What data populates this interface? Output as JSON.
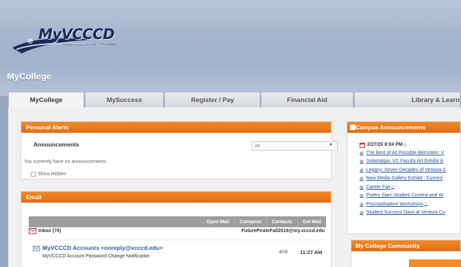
{
  "brand": {
    "logo_text": "MyVCCCD",
    "logo_tagline": "Ventura County Community College District",
    "site_title": "MyCollege"
  },
  "tabs": [
    {
      "label": "MyCollege",
      "active": true
    },
    {
      "label": "MySuccess",
      "active": false
    },
    {
      "label": "Register / Pay",
      "active": false
    },
    {
      "label": "Financial Aid",
      "active": false
    },
    {
      "label": "Library & Learn",
      "active": false
    }
  ],
  "alerts": {
    "header": "Personal Alerts",
    "announcements_title": "Announcements",
    "filter_value": "All",
    "empty_text": "You currently have no announcements.",
    "show_hidden_label": "Show Hidden"
  },
  "email": {
    "header": "Email",
    "toolbar": [
      "Open Mail",
      "Compose",
      "Contacts",
      "Get Mail"
    ],
    "inbox_label": "Inbox (70)",
    "account": "FuturePirateFall2019@my.vcccd.edu",
    "messages": [
      {
        "from": "MyVCCCD Accounts <noreply@vcccd.edu>",
        "subject": "MyVCCCD Account Password Change Notification",
        "size": "4KB",
        "time": "11:27 AM"
      }
    ]
  },
  "campus": {
    "header": "Campus Announcements",
    "date": "2/27/20 8:04 PM",
    "items": [
      "The Best of All Possible Bernstein: V",
      "Solastalgia: VC Faculty Art Exhibit &",
      "Legacy: Seven Decades of Ventura C",
      "New Media Gallery Exhibit : Current",
      "Career Fair",
      "Poetry Slam Student Contest and W",
      "Procrastination Workshops",
      "Student Success Days at Ventura Co"
    ]
  },
  "community": {
    "header": "My College Community"
  },
  "colors": {
    "accent": "#e8781c",
    "link": "#1f4f96",
    "toolbar": "#9d9d9d"
  }
}
